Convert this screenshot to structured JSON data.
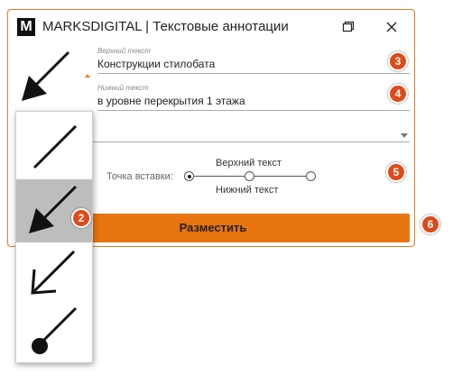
{
  "window": {
    "logo": "M",
    "title": "MARKSDIGITAL | Текстовые аннотации",
    "controls": [
      "restore-icon",
      "close-icon"
    ]
  },
  "top_text": {
    "hint": "Верхний текст",
    "value": "Конструкции стилобата"
  },
  "bottom_text": {
    "hint": "Нижний текст",
    "value": "в уровне перекрытия 1 этажа"
  },
  "insertion_point": {
    "label": "Точка вставки:",
    "top_label": "Верхний текст",
    "bottom_label": "Нижний текст",
    "options": [
      {
        "selected": true
      },
      {
        "selected": false
      },
      {
        "selected": false
      }
    ]
  },
  "place_button": {
    "label": "Разместить"
  },
  "arrow_popup": {
    "options": [
      {
        "icon": "plain-line-icon",
        "selected": false
      },
      {
        "icon": "filled-arrow-icon",
        "selected": true
      },
      {
        "icon": "open-arrow-icon",
        "selected": false
      },
      {
        "icon": "dot-line-icon",
        "selected": false
      }
    ]
  },
  "badges": {
    "b2": "2",
    "b3": "3",
    "b4": "4",
    "b5": "5",
    "b6": "6"
  },
  "colors": {
    "accent": "#e8740f",
    "badge": "#e04a1a",
    "selected_bg": "#bdbdbd"
  }
}
